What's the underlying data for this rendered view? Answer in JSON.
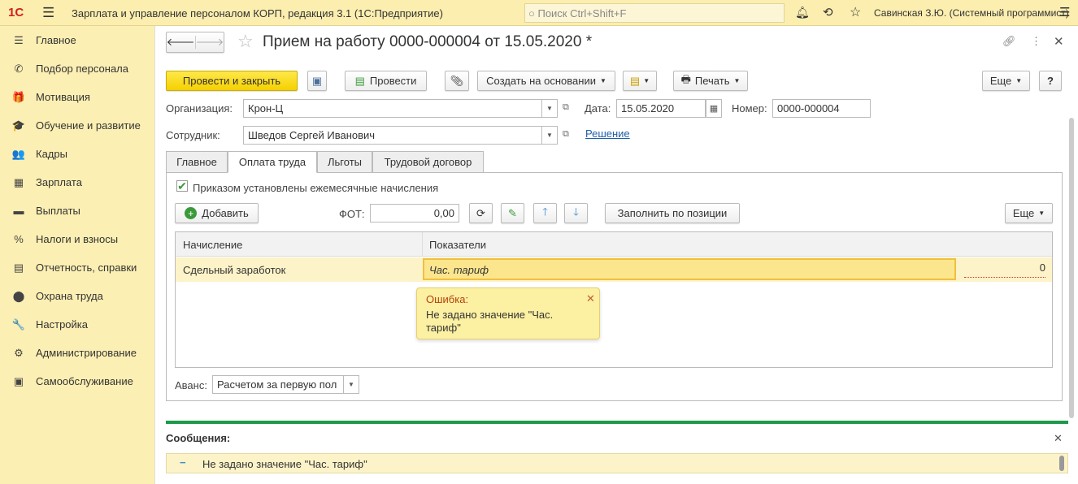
{
  "app": {
    "title": "Зарплата и управление персоналом КОРП, редакция 3.1  (1С:Предприятие)",
    "search_placeholder": "Поиск Ctrl+Shift+F",
    "user": "Савинская З.Ю. (Системный программист)",
    "logo": "1С"
  },
  "sidebar": {
    "items": [
      {
        "label": "Главное",
        "icon": "☰"
      },
      {
        "label": "Подбор персонала",
        "icon": "✆"
      },
      {
        "label": "Мотивация",
        "icon": "🎁"
      },
      {
        "label": "Обучение и развитие",
        "icon": "🎓"
      },
      {
        "label": "Кадры",
        "icon": "👥"
      },
      {
        "label": "Зарплата",
        "icon": "▦"
      },
      {
        "label": "Выплаты",
        "icon": "▬"
      },
      {
        "label": "Налоги и взносы",
        "icon": "%"
      },
      {
        "label": "Отчетность, справки",
        "icon": "▤"
      },
      {
        "label": "Охрана труда",
        "icon": "⬤"
      },
      {
        "label": "Настройка",
        "icon": "🔧"
      },
      {
        "label": "Администрирование",
        "icon": "⚙"
      },
      {
        "label": "Самообслуживание",
        "icon": "▣"
      }
    ]
  },
  "doc": {
    "title": "Прием на работу 0000-000004 от 15.05.2020 *"
  },
  "toolbar": {
    "post_close": "Провести и закрыть",
    "post": "Провести",
    "create_based": "Создать на основании",
    "print": "Печать",
    "more": "Еще",
    "help": "?"
  },
  "form": {
    "org_label": "Организация:",
    "org_value": "Крон-Ц",
    "date_label": "Дата:",
    "date_value": "15.05.2020",
    "number_label": "Номер:",
    "number_value": "0000-000004",
    "employee_label": "Сотрудник:",
    "employee_value": "Шведов Сергей Иванович",
    "decision_link": "Решение"
  },
  "tabs": [
    {
      "label": "Главное"
    },
    {
      "label": "Оплата труда"
    },
    {
      "label": "Льготы"
    },
    {
      "label": "Трудовой договор"
    }
  ],
  "pay": {
    "checkbox_label": "Приказом установлены ежемесячные начисления",
    "add": "Добавить",
    "fot_label": "ФОТ:",
    "fot_value": "0,00",
    "fill_by_position": "Заполнить по позиции",
    "more": "Еще",
    "columns": [
      "Начисление",
      "Показатели"
    ],
    "rows": [
      {
        "accrual": "Сдельный заработок",
        "indicator": "Час. тариф",
        "value": "0"
      }
    ],
    "advance_label": "Аванс:",
    "advance_value": "Расчетом за первую пол"
  },
  "tooltip": {
    "title": "Ошибка:",
    "text": "Не задано значение \"Час. тариф\""
  },
  "messages": {
    "title": "Сообщения:",
    "items": [
      "Не задано значение \"Час. тариф\""
    ]
  }
}
